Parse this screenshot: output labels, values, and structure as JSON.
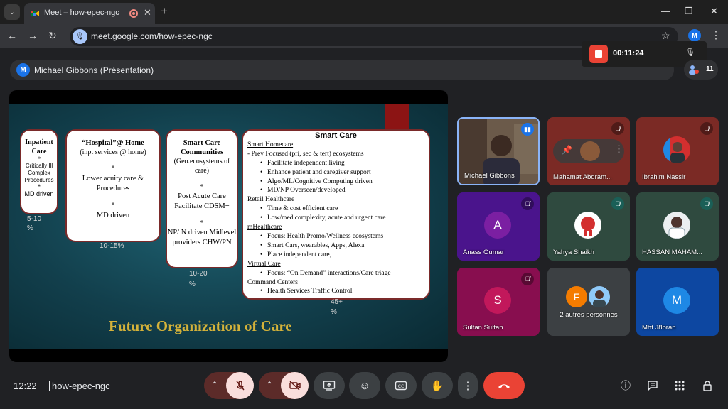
{
  "browser": {
    "tab_title": "Meet – how-epec-ngc",
    "url": "meet.google.com/how-epec-ngc",
    "profile_initial": "M"
  },
  "meeting": {
    "presenter_label": "Michael Gibbons (Présentation)",
    "presenter_initial": "M",
    "recording_time": "00:11:24",
    "participant_count": "11",
    "clock": "12:22",
    "meeting_code": "how-epec-ngc"
  },
  "slide": {
    "box1": {
      "title": "Inpatient Care",
      "star1": "*",
      "body": "Critically Ill Complex Procedures",
      "star2": "*",
      "footer": "MD driven"
    },
    "box2": {
      "title": "“Hospital”@ Home",
      "subtitle": "(inpt services @ home)",
      "star1": "*",
      "body": "Lower acuity care & Procedures",
      "star2": "*",
      "footer": "MD driven"
    },
    "box3": {
      "title": "Smart Care Communities",
      "subtitle": "(Geo.ecosystems of care)",
      "star1": "*",
      "body": "Post Acute Care Facilitate CDSM+",
      "star2": "*",
      "footer": "NP/ N driven Midlevel providers CHW/PN"
    },
    "box4": {
      "title": "Smart Care",
      "h1": "Smart Homecare",
      "l0": "- Prev Focused (pri, sec & tert) ecosystems",
      "l1": "Facilitate independent living",
      "l2": "Enhance patient and caregiver support",
      "l3": "Algo/ML/Cognitive Computing driven",
      "l4": "MD/NP Overseen/developed",
      "h2": "Retail Healthcare",
      "l5": "Time  & cost efficient care",
      "l6": "Low/med complexity, acute and urgent care",
      "h3": "mHealthcare",
      "l7": "Focus: Health Promo/Wellness ecosystems",
      "l8": "Smart Cars, wearables, Apps, Alexa",
      "l9": "Place independent care,",
      "h4": "Virtual Care",
      "l10": "Focus: “On Demand” interactions/Care triage",
      "h5": "Command Centers",
      "l11": "Health Services Traffic Control"
    },
    "pct1": "5-10",
    "pct1b": "%",
    "pct2": "10-15%",
    "pct3": "10-20",
    "pct3b": "%",
    "pct4": "45+",
    "pct4b": "%",
    "title": "Future Organization of Care"
  },
  "participants": [
    {
      "name": "Michael Gibbons",
      "speaking": true
    },
    {
      "name": "Mahamat Abdram..."
    },
    {
      "name": "Ibrahim Nassir"
    },
    {
      "name": "Anass Oumar",
      "initial": "A",
      "color": "#7b1fa2"
    },
    {
      "name": "Yahya Shaikh"
    },
    {
      "name": "HASSAN MAHAM..."
    },
    {
      "name": "Sultan Sultan",
      "initial": "S",
      "color": "#c2185b"
    },
    {
      "name": "2 autres personnes",
      "initial": "F",
      "color": "#f57c00"
    },
    {
      "name": "Mht J8bran",
      "initial": "M",
      "color": "#1e88e5"
    }
  ],
  "colors": {
    "end_call": "#ea4335",
    "muted_bg": "#f9dedc",
    "accent": "#8ab4f8"
  }
}
